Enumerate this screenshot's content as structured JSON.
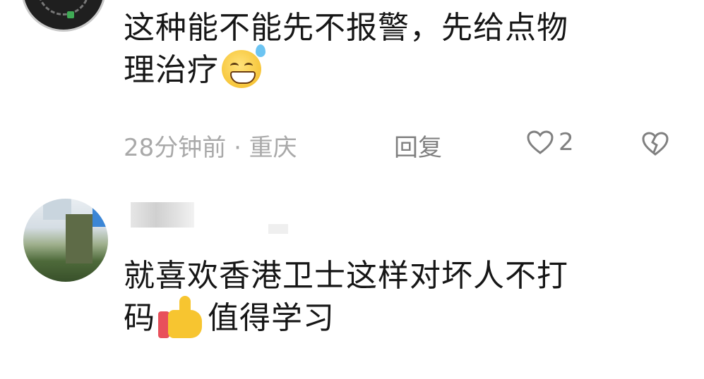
{
  "comments": [
    {
      "text_line1": "这种能不能先不报警，先给点物",
      "text_line2": "理治疗",
      "emoji": "sweat-smile-emoji",
      "meta": {
        "time_location": "28分钟前 · 重庆",
        "reply_label": "回复",
        "like_count": "2"
      }
    },
    {
      "text_line1": "就喜欢香港卫士这样对坏人不打",
      "text_line2_a": "码",
      "emoji": "thumbs-up-emoji",
      "text_line2_b": "值得学习"
    }
  ],
  "colors": {
    "text": "#161616",
    "meta": "#a9a9a9",
    "action": "#808080"
  }
}
